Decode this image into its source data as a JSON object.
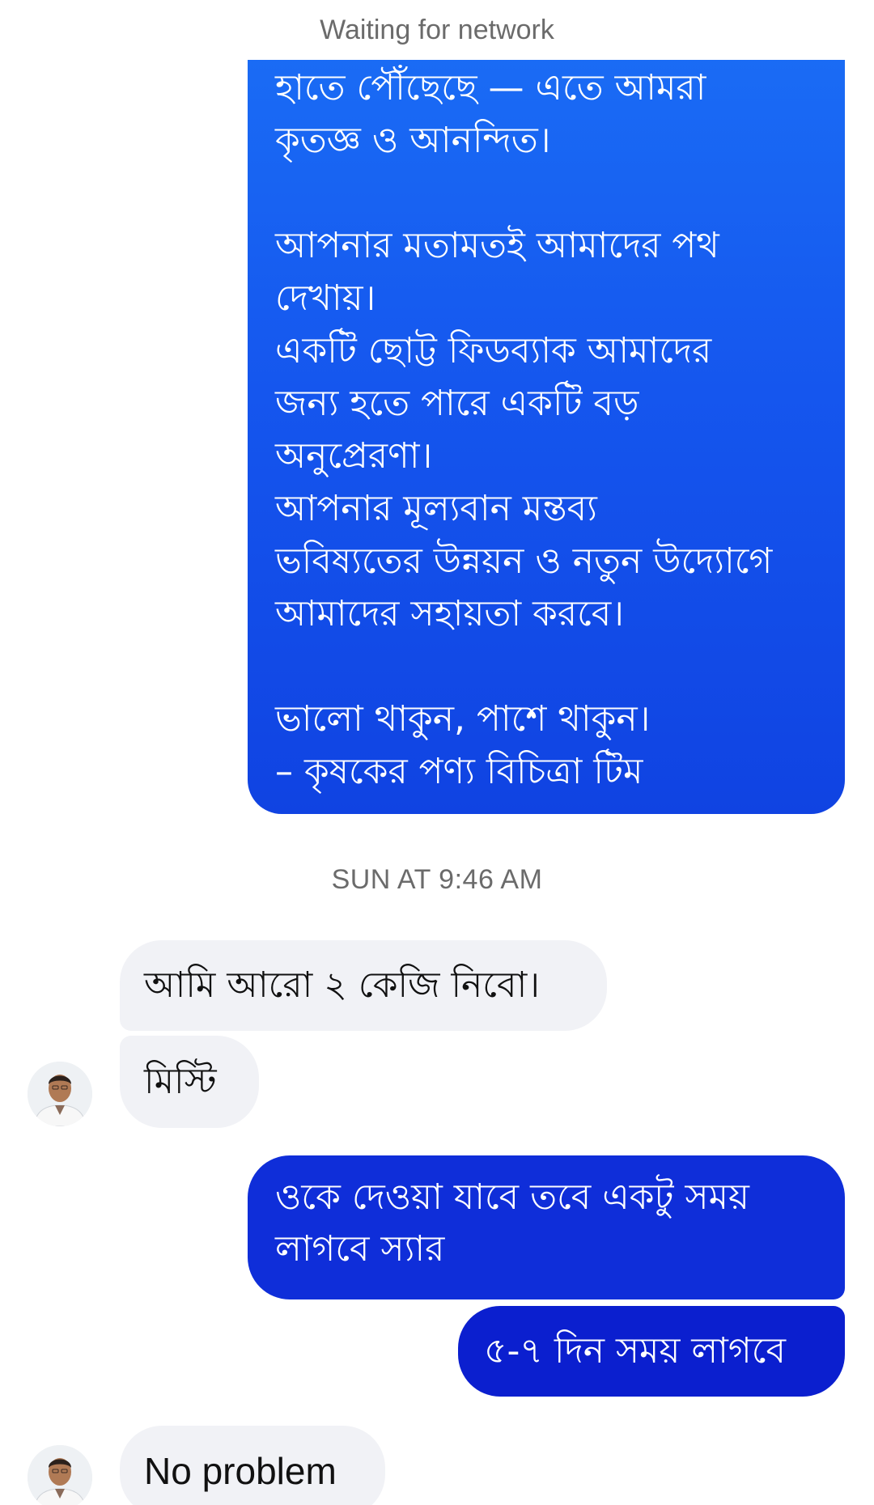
{
  "status": {
    "network_text": "Waiting for network"
  },
  "messages": {
    "outgoing_long": "হাতে পৌঁছেছে — এতে আমরা\nকৃতজ্ঞ ও আনন্দিত।\n\nআপনার মতামতই আমাদের পথ\nদেখায়।\nএকটি ছোট্ট ফিডব্যাক আমাদের\nজন্য হতে পারে একটি বড়\nঅনুপ্রেরণা।\nআপনার মূল্যবান মন্তব্য\nভবিষ্যতের উন্নয়ন ও নতুন উদ্যোগে\nআমাদের সহায়তা করবে।\n\nভালো থাকুন, পাশে থাকুন।\n– কৃষকের পণ্য বিচিত্রা টিম",
    "timestamp": "SUN AT 9:46 AM",
    "incoming_1": "আমি আরো ২ কেজি নিবো।",
    "incoming_2": "মিস্টি",
    "outgoing_2": "ওকে দেওয়া যাবে তবে একটু সময়\nলাগবে স্যার",
    "outgoing_3": "৫-৭ দিন সময় লাগবে",
    "incoming_3": "No problem"
  },
  "colors": {
    "outgoing_top": "#1a6cf5",
    "outgoing_bottom": "#0b1fcf",
    "incoming_bg": "#f1f2f6",
    "meta_text": "#6b6b6b"
  },
  "icons": {
    "contact_avatar": "profile-photo"
  }
}
